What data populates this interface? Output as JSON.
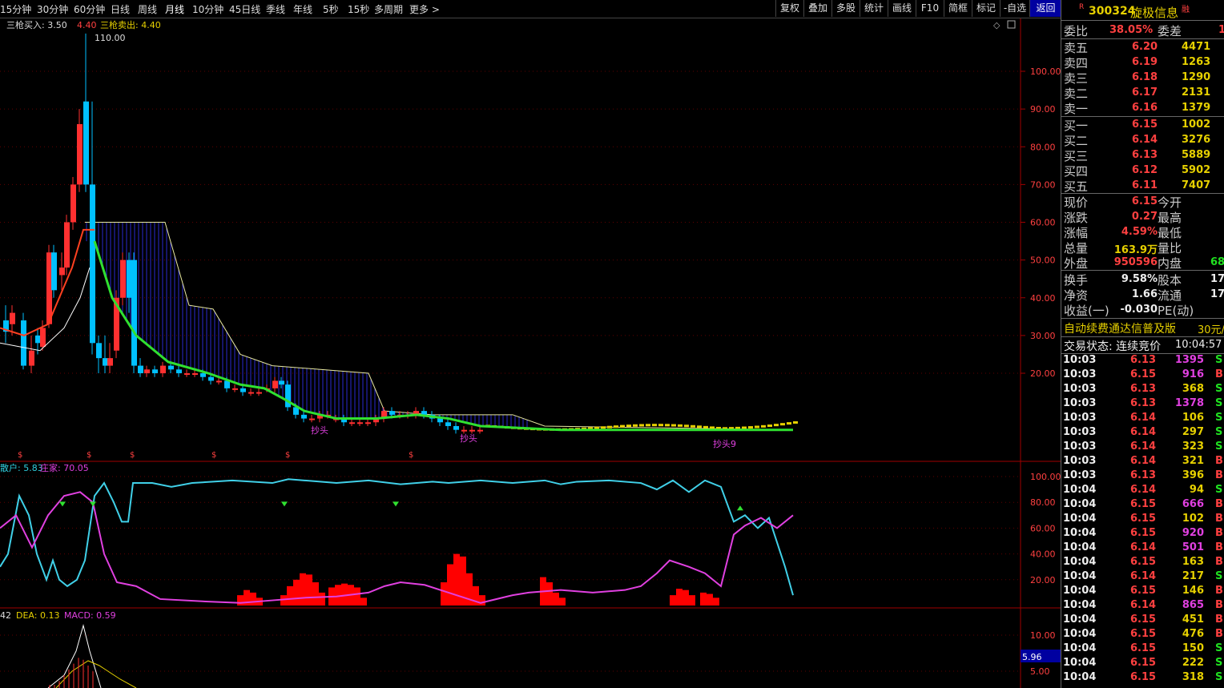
{
  "toolbar": {
    "periods": [
      "15分钟",
      "30分钟",
      "60分钟",
      "日线",
      "周线",
      "月线",
      "10分钟",
      "45日线",
      "季线",
      "年线",
      "5秒",
      "15秒",
      "多周期",
      "更多 >"
    ],
    "active_period": "月线",
    "buttons": [
      "复权",
      "叠加",
      "多股",
      "统计",
      "画线",
      "F10",
      "简框",
      "标记",
      "-自选",
      "返回"
    ]
  },
  "main_chart": {
    "legend_buy_label": "三枪买入: 3.50",
    "legend_val": "4.40",
    "legend_sell_label": "三枪卖出: 4.40",
    "peak_label": "110.00",
    "y_ticks": [
      "100.00",
      "90.00",
      "80.00",
      "70.00",
      "60.00",
      "50.00",
      "40.00",
      "30.00",
      "20.00"
    ],
    "annot1": "抄头",
    "annot2": "抄头",
    "annot3": "抄头9",
    "colors": {
      "up": "#ff3030",
      "down": "#00c0ff",
      "ma": "#30e030",
      "band": "#2020c0"
    }
  },
  "indicator1": {
    "legend_retail": "散户: 5.83",
    "legend_dealer": "庄家: 70.05",
    "y_ticks": [
      "100.00",
      "80.00",
      "60.00",
      "40.00",
      "20.00"
    ]
  },
  "indicator2": {
    "legend_dif": "42",
    "legend_dea": "DEA: 0.13",
    "legend_macd": "MACD: 0.59",
    "y_ticks": [
      "10.00",
      "5.00"
    ],
    "current_value": "5.96"
  },
  "quote": {
    "code_badge": "R",
    "code": "300324",
    "name": "旋极信息",
    "tag": "融",
    "weibi_label": "委比",
    "weibi_value": "38.05%",
    "weicha_label": "委差",
    "weicha_value": "1",
    "asks": [
      {
        "label": "卖五",
        "price": "6.20",
        "vol": "4471"
      },
      {
        "label": "卖四",
        "price": "6.19",
        "vol": "1263"
      },
      {
        "label": "卖三",
        "price": "6.18",
        "vol": "1290"
      },
      {
        "label": "卖二",
        "price": "6.17",
        "vol": "2131"
      },
      {
        "label": "卖一",
        "price": "6.16",
        "vol": "1379"
      }
    ],
    "bids": [
      {
        "label": "买一",
        "price": "6.15",
        "vol": "1002"
      },
      {
        "label": "买二",
        "price": "6.14",
        "vol": "3276"
      },
      {
        "label": "买三",
        "price": "6.13",
        "vol": "5889"
      },
      {
        "label": "买四",
        "price": "6.12",
        "vol": "5902"
      },
      {
        "label": "买五",
        "price": "6.11",
        "vol": "7407"
      }
    ],
    "stats1": [
      {
        "label": "现价",
        "value": "6.15",
        "label2": "今开",
        "value2": ""
      },
      {
        "label": "涨跌",
        "value": "0.27",
        "label2": "最高",
        "value2": ""
      },
      {
        "label": "涨幅",
        "value": "4.59%",
        "label2": "最低",
        "value2": ""
      },
      {
        "label": "总量",
        "value": "163.9万",
        "label2": "量比",
        "value2": ""
      },
      {
        "label": "外盘",
        "value": "950596",
        "label2": "内盘",
        "value2": "68"
      }
    ],
    "stats2": [
      {
        "label": "换手",
        "value": "9.58%",
        "label2": "股本",
        "value2": "17"
      },
      {
        "label": "净资",
        "value": "1.66",
        "label2": "流通",
        "value2": "17"
      },
      {
        "label": "收益(一)",
        "value": "-0.030",
        "label2": "PE(动)",
        "value2": ""
      }
    ],
    "promo": "自动续费通达信普及版",
    "promo_price": "30元/",
    "status_label": "交易状态: 连续竞价",
    "status_time": "10:04:57",
    "ticks": [
      {
        "t": "10:03",
        "p": "6.13",
        "v": "1395",
        "s": "S"
      },
      {
        "t": "10:03",
        "p": "6.15",
        "v": "916",
        "s": "B"
      },
      {
        "t": "10:03",
        "p": "6.13",
        "v": "368",
        "s": "S"
      },
      {
        "t": "10:03",
        "p": "6.13",
        "v": "1378",
        "s": "S"
      },
      {
        "t": "10:03",
        "p": "6.14",
        "v": "106",
        "s": "S"
      },
      {
        "t": "10:03",
        "p": "6.14",
        "v": "297",
        "s": "S"
      },
      {
        "t": "10:03",
        "p": "6.14",
        "v": "323",
        "s": "S"
      },
      {
        "t": "10:03",
        "p": "6.14",
        "v": "321",
        "s": "B"
      },
      {
        "t": "10:03",
        "p": "6.13",
        "v": "396",
        "s": "B"
      },
      {
        "t": "10:04",
        "p": "6.14",
        "v": "94",
        "s": "S"
      },
      {
        "t": "10:04",
        "p": "6.15",
        "v": "666",
        "s": "B"
      },
      {
        "t": "10:04",
        "p": "6.15",
        "v": "102",
        "s": "B"
      },
      {
        "t": "10:04",
        "p": "6.15",
        "v": "920",
        "s": "B"
      },
      {
        "t": "10:04",
        "p": "6.14",
        "v": "501",
        "s": "B"
      },
      {
        "t": "10:04",
        "p": "6.15",
        "v": "163",
        "s": "B"
      },
      {
        "t": "10:04",
        "p": "6.14",
        "v": "217",
        "s": "S"
      },
      {
        "t": "10:04",
        "p": "6.15",
        "v": "146",
        "s": "B"
      },
      {
        "t": "10:04",
        "p": "6.14",
        "v": "865",
        "s": "B"
      },
      {
        "t": "10:04",
        "p": "6.15",
        "v": "451",
        "s": "B"
      },
      {
        "t": "10:04",
        "p": "6.15",
        "v": "476",
        "s": "B"
      },
      {
        "t": "10:04",
        "p": "6.15",
        "v": "150",
        "s": "S"
      },
      {
        "t": "10:04",
        "p": "6.15",
        "v": "222",
        "s": "S"
      },
      {
        "t": "10:04",
        "p": "6.15",
        "v": "318",
        "s": "S"
      }
    ]
  }
}
